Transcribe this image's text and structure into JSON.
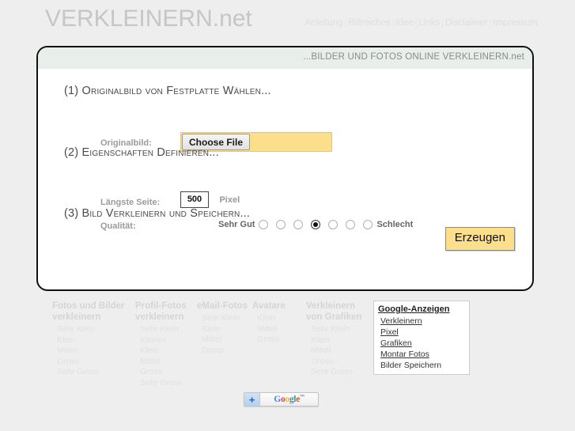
{
  "header": {
    "logo": "VERKLEINERN.net",
    "nav": [
      {
        "label": "Anleitung"
      },
      {
        "label": "Hilfreiches"
      },
      {
        "label": "Idee"
      },
      {
        "label": "Links"
      },
      {
        "label": "Disclaimer"
      },
      {
        "label": "Impressum"
      }
    ],
    "separator": "|"
  },
  "box": {
    "tagline": "...BILDER UND FOTOS ONLINE VERKLEINERN.net",
    "step1": {
      "title": "(1) Originalbild von Festplatte Wählen...",
      "label": "Originalbild:",
      "choose_file_label": "Choose File",
      "file_value": ""
    },
    "step2": {
      "title": "(2) Eigenschaften Definieren...",
      "label_longest_side": "Längste Seite:",
      "pixel_value": "500",
      "pixel_unit": "Pixel",
      "label_quality": "Qualität:",
      "quality_min_label": "Sehr Gut",
      "quality_max_label": "Schlecht",
      "quality_options": 7,
      "quality_selected_index": 3
    },
    "step3": {
      "title": "(3) Bild Verkleinern und Speichern...",
      "submit_label": "Erzeugen"
    }
  },
  "footer": {
    "columns": [
      {
        "head": "Fotos und Bilder verkleinern",
        "items": [
          "Sehr Klein",
          "Klein",
          "Mittel",
          "Gross",
          "Sehr Gross"
        ]
      },
      {
        "head": "Profil-Fotos verkleinern",
        "items": [
          "Sehr Klein",
          "Kleiner",
          "Klein",
          "Mittel",
          "Gross",
          "Sehr Gross"
        ]
      },
      {
        "head": "eMail-Fotos",
        "items": [
          "Sehr Klein",
          "Klein",
          "Mittel",
          "Gross"
        ]
      },
      {
        "head": "Avatare",
        "items": [
          "Klein",
          "Mittel",
          "Gross"
        ]
      },
      {
        "head": "Verkleinern von Grafiken",
        "items": [
          "Sehr Klein",
          "Klein",
          "Mittel",
          "Gross",
          "Sehr Gross"
        ]
      }
    ],
    "ads": {
      "title": "Google-Anzeigen",
      "items": [
        "Verkleinern",
        "Pixel",
        "Grafiken",
        "Montar Fotos",
        "Bilder Speichern"
      ]
    }
  },
  "gplus": {
    "plus": "+",
    "word": "Google",
    "tm": "™"
  },
  "colors": {
    "page_bg": "#eeeeee",
    "box_border": "#111111",
    "box_header_bg": "#e8eeea",
    "accent_yellow": "#fbdf8a",
    "logo_gray": "#c6c6c6",
    "footer_gray": "#e0e0e0"
  }
}
